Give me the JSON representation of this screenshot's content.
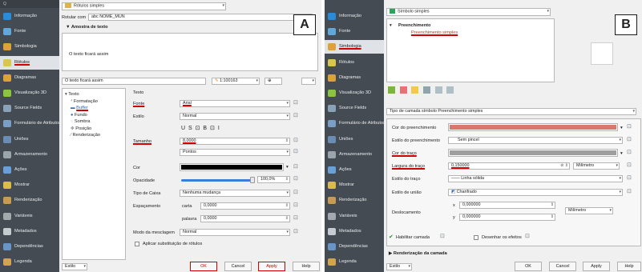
{
  "panelA": {
    "letter": "A",
    "sidebar": [
      {
        "label": "Informação",
        "color": "#2a8bd8"
      },
      {
        "label": "Fonte",
        "color": "#5fa8d9"
      },
      {
        "label": "Simbologia",
        "color": "#e0a13a"
      },
      {
        "label": "Rótulos",
        "color": "#d8c84a"
      },
      {
        "label": "Diagramas",
        "color": "#d9a23c"
      },
      {
        "label": "Visualização 3D",
        "color": "#8cc43f"
      },
      {
        "label": "Source Fields",
        "color": "#8aa2b8"
      },
      {
        "label": "Formulário de Atributos",
        "color": "#7b9ec6"
      },
      {
        "label": "Uniões",
        "color": "#6b8db5"
      },
      {
        "label": "Armazenamento",
        "color": "#9aa5ad"
      },
      {
        "label": "Ações",
        "color": "#6aa0d8"
      },
      {
        "label": "Mostrar",
        "color": "#dbbd43"
      },
      {
        "label": "Renderização",
        "color": "#c79b53"
      },
      {
        "label": "Variáveis",
        "color": "#a4a9ae"
      },
      {
        "label": "Metadados",
        "color": "#c6cbd0"
      },
      {
        "label": "Dependências",
        "color": "#6894c6"
      },
      {
        "label": "Legenda",
        "color": "#d4a44c"
      }
    ],
    "header_title": "Rótulos simples",
    "rotular_com_label": "Rotular com",
    "rotular_com_value": "abc NOME_MUN",
    "preview_section": "▼ Amostra de texto",
    "preview_text": "O texto ficará assim",
    "preview_field": "O texto ficará assim",
    "scale": "1:100163",
    "tree": [
      "Texto",
      "Formatação",
      "Buffer",
      "Fundo",
      "Sombra",
      "Posição",
      "Renderização"
    ],
    "texto_heading": "Texto",
    "font_label": "Fonte",
    "font_value": "Arial",
    "estilo_label": "Estilo",
    "estilo_value": "Normal",
    "format_buttons": "U  S  ⊡         B  ⊡  I",
    "tamanho_label": "Tamanho",
    "tamanho_value": "8,0000",
    "units_value": "Pontos",
    "cor_label": "Cor",
    "opacidade_label": "Opacidade",
    "opacidade_value": "100,0%",
    "tipo_caixa_label": "Tipo de Caixa",
    "tipo_caixa_value": "Nenhuma mudança",
    "espacamento_label": "Espaçamento",
    "carta_label": "carta",
    "carta_value": "0,0000",
    "palavra_label": "palavra",
    "palavra_value": "0,0000",
    "modo_label": "Modo da mesclagem",
    "modo_value": "Normal",
    "aplicar_label": "Aplicar substituição de rótulos",
    "estilo_bottom": "Estilo",
    "ok": "OK",
    "cancel": "Cancel",
    "apply": "Apply",
    "help": "Help"
  },
  "panelB": {
    "letter": "B",
    "header_title": "Símbolo simples",
    "sidebar": [
      {
        "label": "Informação",
        "color": "#2a8bd8"
      },
      {
        "label": "Fonte",
        "color": "#5fa8d9"
      },
      {
        "label": "Simbologia",
        "color": "#e0a13a"
      },
      {
        "label": "Rótulos",
        "color": "#d8c84a"
      },
      {
        "label": "Diagramas",
        "color": "#d9a23c"
      },
      {
        "label": "Visualização 3D",
        "color": "#8cc43f"
      },
      {
        "label": "Source Fields",
        "color": "#8aa2b8"
      },
      {
        "label": "Formulário de Atributos",
        "color": "#7b9ec6"
      },
      {
        "label": "Uniões",
        "color": "#6b8db5"
      },
      {
        "label": "Armazenamento",
        "color": "#9aa5ad"
      },
      {
        "label": "Ações",
        "color": "#6aa0d8"
      },
      {
        "label": "Mostrar",
        "color": "#dbbd43"
      },
      {
        "label": "Renderização",
        "color": "#c79b53"
      },
      {
        "label": "Variáveis",
        "color": "#a4a9ae"
      },
      {
        "label": "Metadados",
        "color": "#c6cbd0"
      },
      {
        "label": "Dependências",
        "color": "#6894c6"
      },
      {
        "label": "Legenda",
        "color": "#d4a44c"
      }
    ],
    "tree_root": "Preenchimento",
    "tree_child": "Preenchimento simples",
    "tipo_camada": "Tipo de camada símbolo Preenchimento simples",
    "cor_preench_label": "Cor do preenchimento",
    "fill_color": "#d9776a",
    "estilo_preench_label": "Estilo do preenchimento",
    "estilo_preench_value": "Sem pincel",
    "cor_traco_label": "Cor do traço",
    "traco_color": "#9e9e9e",
    "largura_label": "Largura do traço",
    "largura_value": "0,150000",
    "largura_unit": "Milímetro",
    "estilo_traco_label": "Estilo do traço",
    "estilo_traco_value": "—— Linha sólida",
    "estilo_uniao_label": "Estilo de união",
    "estilo_uniao_value": "Chanfrado",
    "deslocamento_label": "Deslocamento",
    "x_label": "x",
    "x_value": "0,000000",
    "y_label": "y",
    "y_value": "0,000000",
    "desloc_unit": "Milímetro",
    "habilitar_label": "Habilitar camada",
    "desenhar_label": "Desenhar os efeitos",
    "renderizacao_label": "▶ Renderização da camada",
    "estilo_bottom": "Estilo",
    "ok": "OK",
    "cancel": "Cancel",
    "apply": "Apply",
    "help": "Help"
  }
}
